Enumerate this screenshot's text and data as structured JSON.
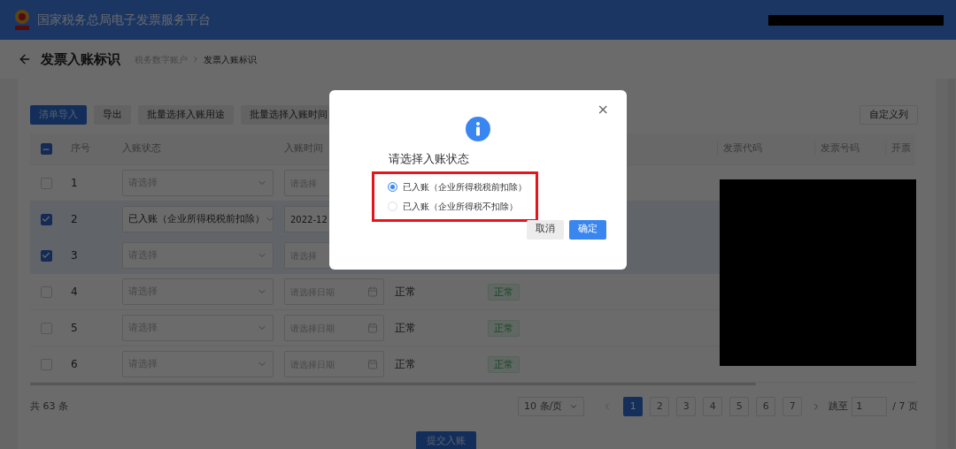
{
  "header": {
    "title": "国家税务总局电子发票服务平台"
  },
  "page": {
    "title": "发票入账标识",
    "breadcrumb": [
      "税务数字账户",
      "发票入账标识"
    ]
  },
  "toolbar": {
    "buttons": [
      {
        "label": "清单导入",
        "kind": "primary"
      },
      {
        "label": "导出",
        "kind": "default"
      },
      {
        "label": "批量选择入账用途",
        "kind": "default"
      },
      {
        "label": "批量选择入账时间",
        "kind": "default"
      }
    ],
    "custom_columns": "自定义列"
  },
  "table": {
    "select_all": {
      "indeterminate": true
    },
    "columns": {
      "no": "序号",
      "status": "入账状态",
      "time": "入账时间",
      "code": "发票代码",
      "number": "发票号码",
      "date": "开票"
    },
    "rows": [
      {
        "no": "1",
        "checked": false,
        "status": {
          "placeholder": "请选择"
        },
        "time": {
          "placeholder": "请选择"
        }
      },
      {
        "no": "2",
        "checked": true,
        "status": {
          "value": "已入账（企业所得税税前扣除）"
        },
        "time": {
          "value": "2022-12"
        }
      },
      {
        "no": "3",
        "checked": true,
        "status": {
          "placeholder": "请选择"
        },
        "time": {
          "placeholder": "请选择"
        }
      },
      {
        "no": "4",
        "checked": false,
        "status": {
          "placeholder": "请选择"
        },
        "time": {
          "placeholder": "请选择日期"
        },
        "state": "正常",
        "tag": "正常"
      },
      {
        "no": "5",
        "checked": false,
        "status": {
          "placeholder": "请选择"
        },
        "time": {
          "placeholder": "请选择日期"
        },
        "state": "正常",
        "tag": "正常"
      },
      {
        "no": "6",
        "checked": false,
        "status": {
          "placeholder": "请选择"
        },
        "time": {
          "placeholder": "请选择日期"
        },
        "state": "正常",
        "tag": "正常"
      }
    ]
  },
  "pagination": {
    "total": "共 63 条",
    "page_size": "10 条/页",
    "pages": [
      {
        "label": "1",
        "selected": true
      },
      {
        "label": "2",
        "selected": false
      },
      {
        "label": "3",
        "selected": false
      },
      {
        "label": "4",
        "selected": false
      },
      {
        "label": "5",
        "selected": false
      },
      {
        "label": "6",
        "selected": false
      },
      {
        "label": "7",
        "selected": false
      }
    ],
    "jump_label": "跳至",
    "jump_value": "1",
    "page_count": "/ 7 页"
  },
  "submit": "提交入账",
  "modal": {
    "close": "×",
    "title": "请选择入账状态",
    "options": [
      {
        "label": "已入账（企业所得税税前扣除）",
        "selected": true
      },
      {
        "label": "已入账（企业所得税不扣除）",
        "selected": false
      }
    ],
    "cancel": "取消",
    "confirm": "确定"
  }
}
